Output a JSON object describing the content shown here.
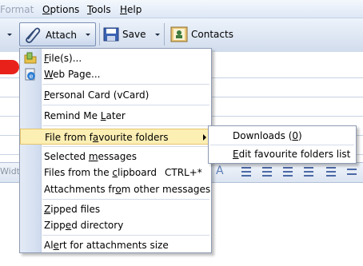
{
  "menubar": {
    "items": [
      {
        "pre": "",
        "key": "",
        "post": "ormat",
        "partial_first": "F"
      },
      {
        "pre": "",
        "key": "O",
        "post": "ptions"
      },
      {
        "pre": "",
        "key": "T",
        "post": "ools"
      },
      {
        "pre": "",
        "key": "H",
        "post": "elp"
      }
    ]
  },
  "toolbar": {
    "attach_label": "Attach",
    "save_label": "Save",
    "contacts_label": "Contacts"
  },
  "format_bar": {
    "width_partial": "Width"
  },
  "attach_menu": {
    "items": [
      {
        "pre": "",
        "key": "F",
        "post": "ile(s)..."
      },
      {
        "pre": "",
        "key": "W",
        "post": "eb Page..."
      },
      {
        "pre": "",
        "key": "P",
        "post": "ersonal Card (vCard)"
      },
      {
        "pre": "Remind Me ",
        "key": "L",
        "post": "ater"
      },
      {
        "pre": "File from f",
        "key": "a",
        "post": "vourite folders"
      },
      {
        "pre": "Selected ",
        "key": "m",
        "post": "essages"
      },
      {
        "pre": "Files from the ",
        "key": "c",
        "post": "lipboard",
        "shortcut": "CTRL+*"
      },
      {
        "pre": "Attachments fr",
        "key": "o",
        "post": "m other messages"
      },
      {
        "pre": "",
        "key": "Z",
        "post": "ipped files"
      },
      {
        "pre": "Zipp",
        "key": "e",
        "post": "d directory"
      },
      {
        "pre": "Al",
        "key": "e",
        "post": "rt for attachments size"
      }
    ]
  },
  "favourites_submenu": {
    "items": [
      {
        "pre": "Downloads (",
        "key": "0",
        "post": ")"
      },
      {
        "pre": "",
        "key": "E",
        "post": "dit favourite folders list"
      }
    ]
  }
}
